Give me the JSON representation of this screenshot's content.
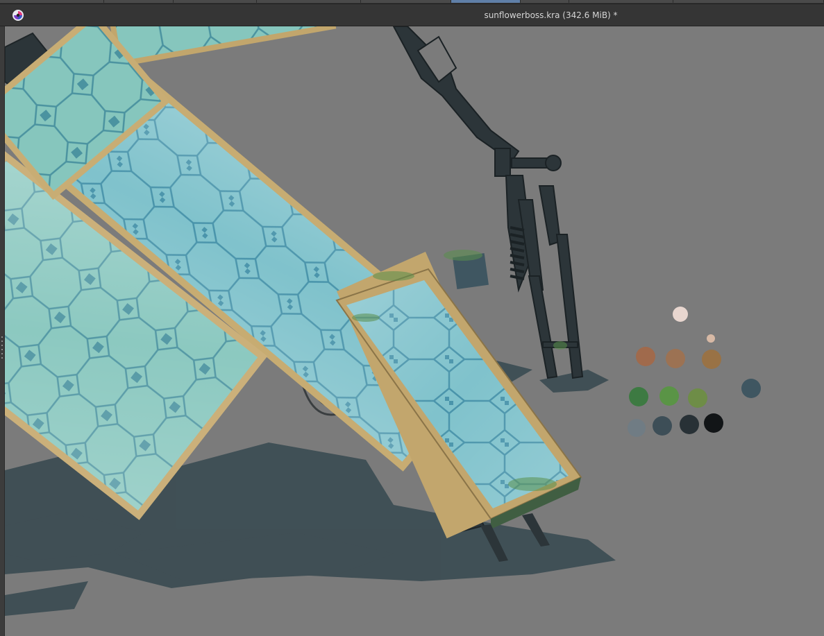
{
  "window": {
    "title": "sunflowerboss.kra (342.6 MiB) *"
  },
  "icons": {
    "app": "krita-app-icon",
    "left_grip": "panel-resize-grip-icon"
  },
  "colors": {
    "canvas_bg": "#7b7b7b",
    "shadow": "#3b4c52",
    "glass": "#7fbfc0",
    "glass_dark": "#5aa3b0",
    "frame": "#c9b07a",
    "metal": "#2c3539"
  },
  "palette_swatches": [
    {
      "name": "skin-light",
      "color": "#e8d6cf"
    },
    {
      "name": "skin-small",
      "color": "#d7b9a5"
    },
    {
      "name": "brown-1",
      "color": "#a06a4c"
    },
    {
      "name": "brown-2",
      "color": "#9c7253"
    },
    {
      "name": "brown-3",
      "color": "#997245"
    },
    {
      "name": "green-1",
      "color": "#3d7a42"
    },
    {
      "name": "green-2",
      "color": "#5a9446"
    },
    {
      "name": "green-3",
      "color": "#6e8d47"
    },
    {
      "name": "slate",
      "color": "#3f5661"
    },
    {
      "name": "gray-blue",
      "color": "#707c84"
    },
    {
      "name": "dark-slate",
      "color": "#3d4e57"
    },
    {
      "name": "charcoal",
      "color": "#283136"
    },
    {
      "name": "black",
      "color": "#121517"
    }
  ]
}
